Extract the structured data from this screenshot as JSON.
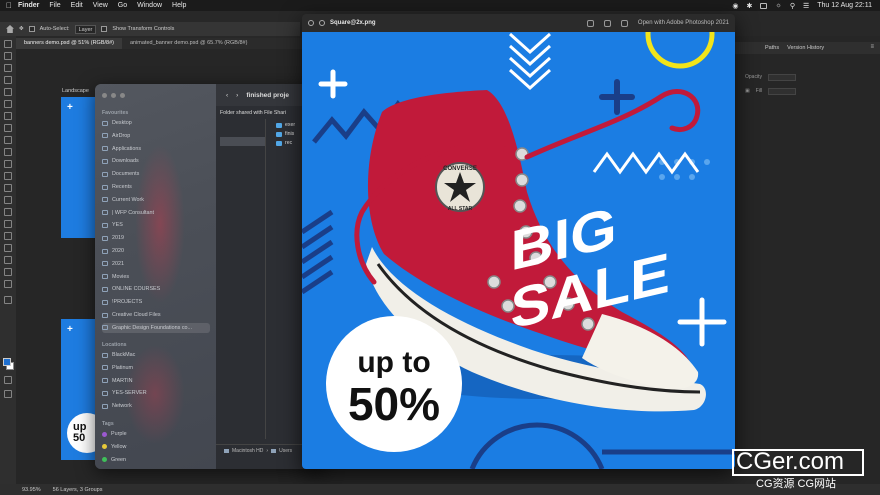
{
  "menubar": {
    "items": [
      "Finder",
      "File",
      "Edit",
      "View",
      "Go",
      "Window",
      "Help"
    ],
    "datetime": "Thu 12 Aug  22:11"
  },
  "options_bar": {
    "auto_select_label": "Auto-Select:",
    "auto_select_value": "Layer",
    "transform_label": "Show Transform Controls"
  },
  "doc_tabs": [
    {
      "label": "banners demo.psd @ 51% (RGB/8#)"
    },
    {
      "label": "animated_banner demo.psd @ 65.7% (RGB/8#)"
    }
  ],
  "artboard": {
    "label": "Landscape",
    "mini_badge_line1": "up",
    "mini_badge_line2": "50"
  },
  "finder": {
    "title": "finished proje",
    "shared_note": "Folder shared with File Shari",
    "favorites_header": "Favourites",
    "favorites": [
      "Desktop",
      "AirDrop",
      "Applications",
      "Downloads",
      "Documents",
      "Recents",
      "Current Work",
      "| WFP Consultant",
      "YES",
      "2019",
      "2020",
      "2021",
      "Movies",
      "ONLINE COURSES",
      "!PROJECTS",
      "Creative Cloud Files",
      "Graphic Design Foundations co..."
    ],
    "locations_header": "Locations",
    "locations": [
      "BlackMac",
      "Platinum",
      "MARTIN",
      "YES-SERVER",
      "Network"
    ],
    "tags_header": "Tags",
    "tags": [
      {
        "label": "Purple",
        "color": "#9b59d0"
      },
      {
        "label": "Yellow",
        "color": "#e8c93a"
      },
      {
        "label": "Green",
        "color": "#3fbf5a"
      }
    ],
    "files": [
      "exer",
      "finis",
      "rec"
    ],
    "path": [
      "Macintosh HD",
      "Users"
    ]
  },
  "quicklook": {
    "filename": "Square@2x.png",
    "open_with": "Open with Adobe Photoshop 2021"
  },
  "banner": {
    "headline_line1": "BIG",
    "headline_line2": "SALE",
    "badge_line1": "up to",
    "badge_line2": "50%",
    "shoe_brand": "CONVERSE",
    "shoe_patch": "ALL STAR",
    "colors": {
      "background": "#1b7de3",
      "shoe": "#c11a3a",
      "accent_yellow": "#f2e41a",
      "navy": "#1a3e88",
      "white": "#ffffff"
    }
  },
  "right_panel": {
    "tabs": [
      "Paths",
      "Version History"
    ],
    "opacity_label": "Opacity",
    "fill_label": "Fill"
  },
  "status": {
    "zoom": "93.95%",
    "layers": "56 Layers, 3 Groups"
  },
  "watermark": {
    "line1": "CGer.com",
    "line2": "CG资源  CG网站"
  }
}
